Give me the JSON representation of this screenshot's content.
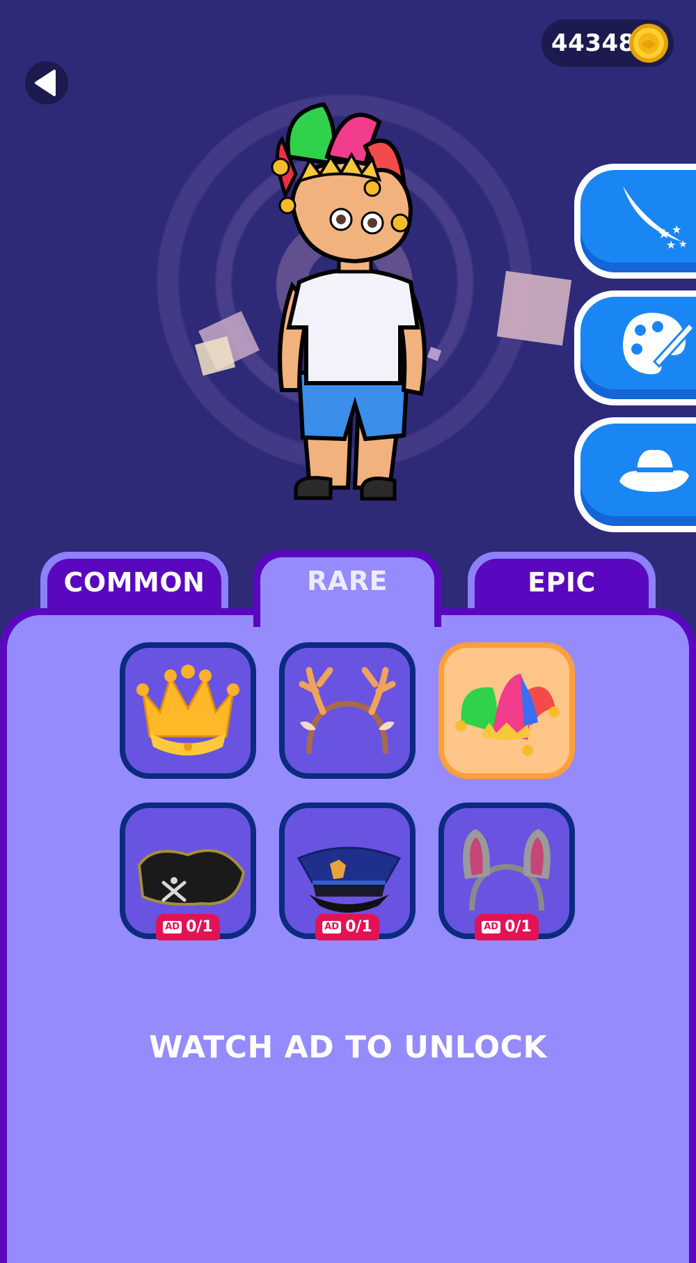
{
  "currency": {
    "coins": "44348",
    "icon": "gold-coin-icon",
    "color": "#f7c21a"
  },
  "navigation": {
    "back_icon": "back-arrow-icon"
  },
  "side_menu": [
    {
      "icon": "shooting-star-trail-icon"
    },
    {
      "icon": "paint-palette-icon"
    },
    {
      "icon": "fedora-hat-icon"
    }
  ],
  "tabs": [
    {
      "label": "COMMON",
      "active": false
    },
    {
      "label": "RARE",
      "active": true
    },
    {
      "label": "EPIC",
      "active": false
    }
  ],
  "items": [
    {
      "icon": "gold-crown-icon",
      "selected": false,
      "locked": false
    },
    {
      "icon": "reindeer-antlers-headband-icon",
      "selected": false,
      "locked": false
    },
    {
      "icon": "jester-hat-icon",
      "selected": true,
      "locked": false
    },
    {
      "icon": "pirate-hat-icon",
      "selected": false,
      "locked": true,
      "ad_tag": "AD",
      "progress": "0/1"
    },
    {
      "icon": "police-cap-icon",
      "selected": false,
      "locked": true,
      "ad_tag": "AD",
      "progress": "0/1"
    },
    {
      "icon": "bunny-ears-headband-icon",
      "selected": false,
      "locked": true,
      "ad_tag": "AD",
      "progress": "0/1"
    }
  ],
  "footer": {
    "unlock_text": "WATCH AD TO UNLOCK"
  },
  "colors": {
    "background": "#2e2a78",
    "panel": "#958bfd",
    "panel_border": "#5a08bf",
    "side_button": "#1a86f4",
    "selected_card": "#ffc589",
    "ad_badge": "#e11356"
  }
}
